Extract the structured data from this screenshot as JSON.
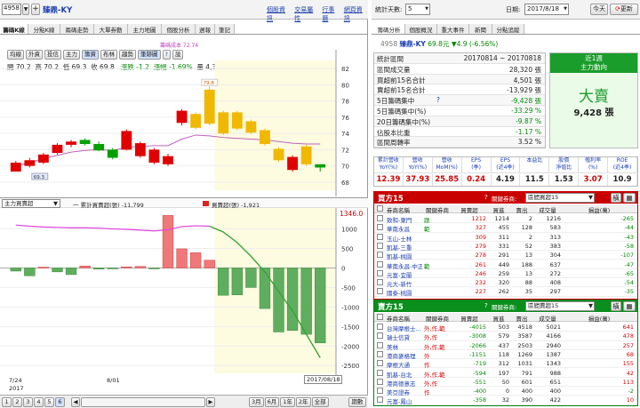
{
  "toolbar": {
    "stock_code": "4958",
    "stock_name": "臻鼎-KY",
    "links": [
      "個股資訊",
      "交易屬性",
      "行事曆",
      "網頁資訊"
    ]
  },
  "left_tabs": [
    "籌碼K線",
    "分點K線",
    "兩碼走勢",
    "大單券動",
    "主力地圖",
    "個股分析",
    "週報",
    "筆記"
  ],
  "sub_tabs": [
    "均線",
    "外資",
    "投信",
    "主力",
    "籌資",
    "布林",
    "趨勢",
    "筆跡圖",
    "設"
  ],
  "cost_label": "籌碼成本 72.74",
  "ohlc": {
    "open_label": "開",
    "open": "70.2",
    "high_label": "高",
    "high": "70.2",
    "low_label": "低",
    "low": "69.3",
    "close_label": "收",
    "close": "69.8",
    "chg_label": "漲跌",
    "chg": "-1.2",
    "pct_label": "漲幅",
    "pct": "-1.69%",
    "vol_label": "量",
    "vol": "4,357"
  },
  "price_axis": [
    "82",
    "80",
    "78",
    "76",
    "74",
    "72",
    "70",
    "68"
  ],
  "hi_label": "79.8",
  "lo_label": "69.3",
  "lower_header": {
    "select": "主力買賣超",
    "series1": "一 累計買賣超(張) -11,799",
    "series2": "買賣超(張) -1,921",
    "value": "1346.0"
  },
  "vol_axis": [
    "1000",
    "500",
    "0",
    "-500",
    "-1000",
    "-1500",
    "-2000",
    "-2500"
  ],
  "date_labels": {
    "d1": "7/24",
    "d1_year": "2017",
    "d2": "8/01",
    "end": "2017/08/18"
  },
  "bottom": {
    "pages": [
      "1",
      "2",
      "3",
      "4",
      "5",
      "6"
    ],
    "periods": [
      "3月",
      "6月",
      "1年",
      "2年",
      "全部"
    ],
    "sort": "期數"
  },
  "right_top": {
    "days_label": "統計天數:",
    "days_value": "5",
    "date_label": "日期:",
    "date_value": "2017/8/18",
    "today_btn": "今天",
    "refresh_btn": "更新"
  },
  "right_tabs": [
    "籌碼分析",
    "個股概況",
    "重大事件",
    "新聞",
    "分點追蹤"
  ],
  "quote": {
    "code": "4958",
    "name": "臻鼎-KY",
    "price": "69.8元",
    "change": "▼4.9 (-6.56%)"
  },
  "stats": [
    {
      "label": "統計區間",
      "value": "20170814 ~ 20170818"
    },
    {
      "label": "區間成交量",
      "value": "28,320 張"
    },
    {
      "label": "買超前15名合計",
      "value": "4,501 張"
    },
    {
      "label": "賣超前15名合計",
      "value": "-13,929 張"
    },
    {
      "label": "5日籌碼集中",
      "value": "-9,428 張"
    },
    {
      "label": "5日籌碼集中(%)",
      "value": "-33.29 %"
    },
    {
      "label": "20日籌碼集中(%)",
      "value": "-9.87 %"
    },
    {
      "label": "佔股本比重",
      "value": "-1.17 %"
    },
    {
      "label": "區間周轉率",
      "value": "3.52 %"
    }
  ],
  "trend": {
    "title1": "近1週",
    "title2": "主力動向",
    "big": "大賣",
    "amount": "9,428 張"
  },
  "metrics": {
    "headers": [
      "累計營收\nYoY(%)",
      "營收\nYoY(%)",
      "營收\nMoM(%)",
      "EPS\n(季)",
      "EPS\n(近4季)",
      "本益比",
      "股價\n淨值比",
      "殖利率\n(%)",
      "ROE\n(近4季)"
    ],
    "values": [
      "12.39",
      "37.93",
      "25.85",
      "0.24",
      "4.19",
      "11.5",
      "1.53",
      "3.07",
      "10.9"
    ]
  },
  "buy": {
    "title": "買方15",
    "filter_label": "關鍵券商:",
    "filter_value": "區間買超15",
    "cols": [
      "券商名稱",
      "關鍵券商",
      "買賣超",
      "買進",
      "賣出",
      "成交量",
      "損益(萬)"
    ],
    "rows": [
      [
        "致和-東門",
        "跟",
        "1212",
        "1214",
        "2",
        "1216",
        "-265"
      ],
      [
        "華南永昌",
        "範",
        "327",
        "455",
        "128",
        "583",
        "-44"
      ],
      [
        "玉山-士林",
        "",
        "309",
        "311",
        "2",
        "313",
        "-43"
      ],
      [
        "凱基-三重",
        "",
        "279",
        "331",
        "52",
        "383",
        "-58"
      ],
      [
        "凱基-桃園",
        "",
        "278",
        "291",
        "13",
        "304",
        "-107"
      ],
      [
        "華南永昌-中正",
        "範",
        "261",
        "449",
        "188",
        "637",
        "-47"
      ],
      [
        "元富-宜蘭",
        "",
        "246",
        "259",
        "13",
        "272",
        "-65"
      ],
      [
        "元大-新竹",
        "",
        "232",
        "320",
        "88",
        "408",
        "-54"
      ],
      [
        "國泰-桃園",
        "",
        "227",
        "262",
        "35",
        "297",
        "-35"
      ]
    ]
  },
  "sell": {
    "title": "賣方15",
    "filter_label": "關鍵券商:",
    "filter_value": "區間賣超15",
    "cols": [
      "券商名稱",
      "關鍵券商",
      "買賣超",
      "買進",
      "賣出",
      "成交量",
      "損益(萬)"
    ],
    "rows": [
      [
        "台灣摩根士…",
        "外,作,範",
        "-4015",
        "503",
        "4518",
        "5021",
        "641"
      ],
      [
        "瑞士信貸",
        "外,作",
        "-3008",
        "579",
        "3587",
        "4166",
        "478"
      ],
      [
        "美林",
        "外,作,範",
        "-2066",
        "437",
        "2503",
        "2940",
        "257"
      ],
      [
        "港商麥格理",
        "外",
        "-1151",
        "118",
        "1269",
        "1387",
        "68"
      ],
      [
        "摩根大通",
        "作",
        "-719",
        "312",
        "1031",
        "1343",
        "155"
      ],
      [
        "凱基-台北",
        "外,作,範",
        "-594",
        "197",
        "791",
        "988",
        "42"
      ],
      [
        "港商德意志",
        "外,作",
        "-551",
        "50",
        "601",
        "651",
        "113"
      ],
      [
        "美亞證券",
        "作",
        "-400",
        "0",
        "400",
        "400",
        "-2"
      ],
      [
        "元富-鳳山",
        "",
        "-358",
        "32",
        "390",
        "422",
        "10"
      ]
    ]
  },
  "chart_data": {
    "type": "bar",
    "candles": [
      {
        "o": 69.3,
        "c": 70.4,
        "h": 70.6,
        "l": 69.3
      },
      {
        "o": 70.0,
        "c": 70.7,
        "h": 71.0,
        "l": 69.8
      },
      {
        "o": 70.4,
        "c": 71.4,
        "h": 71.6,
        "l": 70.2
      },
      {
        "o": 71.6,
        "c": 72.6,
        "h": 72.8,
        "l": 71.4
      },
      {
        "o": 72.6,
        "c": 73.0,
        "h": 73.2,
        "l": 72.3
      },
      {
        "o": 73.2,
        "c": 72.7,
        "h": 73.4,
        "l": 72.5
      },
      {
        "o": 72.7,
        "c": 71.9,
        "h": 73.0,
        "l": 71.8
      },
      {
        "o": 72.0,
        "c": 71.0,
        "h": 72.2,
        "l": 70.8
      },
      {
        "o": 72.0,
        "c": 74.3,
        "h": 74.5,
        "l": 71.9
      },
      {
        "o": 71.2,
        "c": 72.8,
        "h": 73.0,
        "l": 71.0
      },
      {
        "o": 70.4,
        "c": 72.0,
        "h": 72.2,
        "l": 70.2
      },
      {
        "o": 70.2,
        "c": 71.2,
        "h": 71.5,
        "l": 70.0
      },
      {
        "o": 75.3,
        "c": 76.8,
        "h": 77.0,
        "l": 75.0
      },
      {
        "o": 76.4,
        "c": 74.7,
        "h": 76.6,
        "l": 74.5
      },
      {
        "o": 79.4,
        "c": 75.2,
        "h": 79.8,
        "l": 75.0
      },
      {
        "o": 76.6,
        "c": 74.0,
        "h": 76.8,
        "l": 73.8
      },
      {
        "o": 76.6,
        "c": 74.6,
        "h": 76.8,
        "l": 74.4
      },
      {
        "o": 75.5,
        "c": 74.1,
        "h": 75.7,
        "l": 73.9
      },
      {
        "o": 74.4,
        "c": 72.7,
        "h": 74.6,
        "l": 72.5
      },
      {
        "o": 72.1,
        "c": 70.7,
        "h": 72.3,
        "l": 70.5
      },
      {
        "o": 71.1,
        "c": 69.5,
        "h": 71.3,
        "l": 69.3
      },
      {
        "o": 72.4,
        "c": 70.2,
        "h": 72.6,
        "l": 70.0
      },
      {
        "o": 70.2,
        "c": 69.8,
        "h": 70.2,
        "l": 69.3
      }
    ],
    "cost_line": [
      70.0,
      70.4,
      70.9,
      71.3,
      71.7,
      71.9,
      72.0,
      71.9,
      72.3,
      72.4,
      72.5,
      72.5,
      73.3,
      73.8,
      73.7,
      73.5,
      73.4,
      73.3,
      73.2,
      73.0,
      72.8,
      72.7,
      72.7
    ],
    "net_bars": [
      -80,
      -200,
      20,
      -100,
      -170,
      50,
      -30,
      -20,
      30,
      40,
      -10,
      1346,
      490,
      390,
      200,
      -700,
      -690,
      -500,
      -1040,
      -1640,
      -1600,
      -1700,
      -1921
    ],
    "cum_line": [
      1100,
      1070,
      1050,
      1040,
      1030,
      1030,
      1020,
      1000,
      990,
      970,
      950,
      980,
      1060,
      1080,
      1070,
      920,
      650,
      300,
      -100,
      -600,
      -1100,
      -1700,
      -2300
    ],
    "price_ylim": [
      67,
      83
    ],
    "vol_ylim": [
      -2700,
      1400
    ]
  }
}
